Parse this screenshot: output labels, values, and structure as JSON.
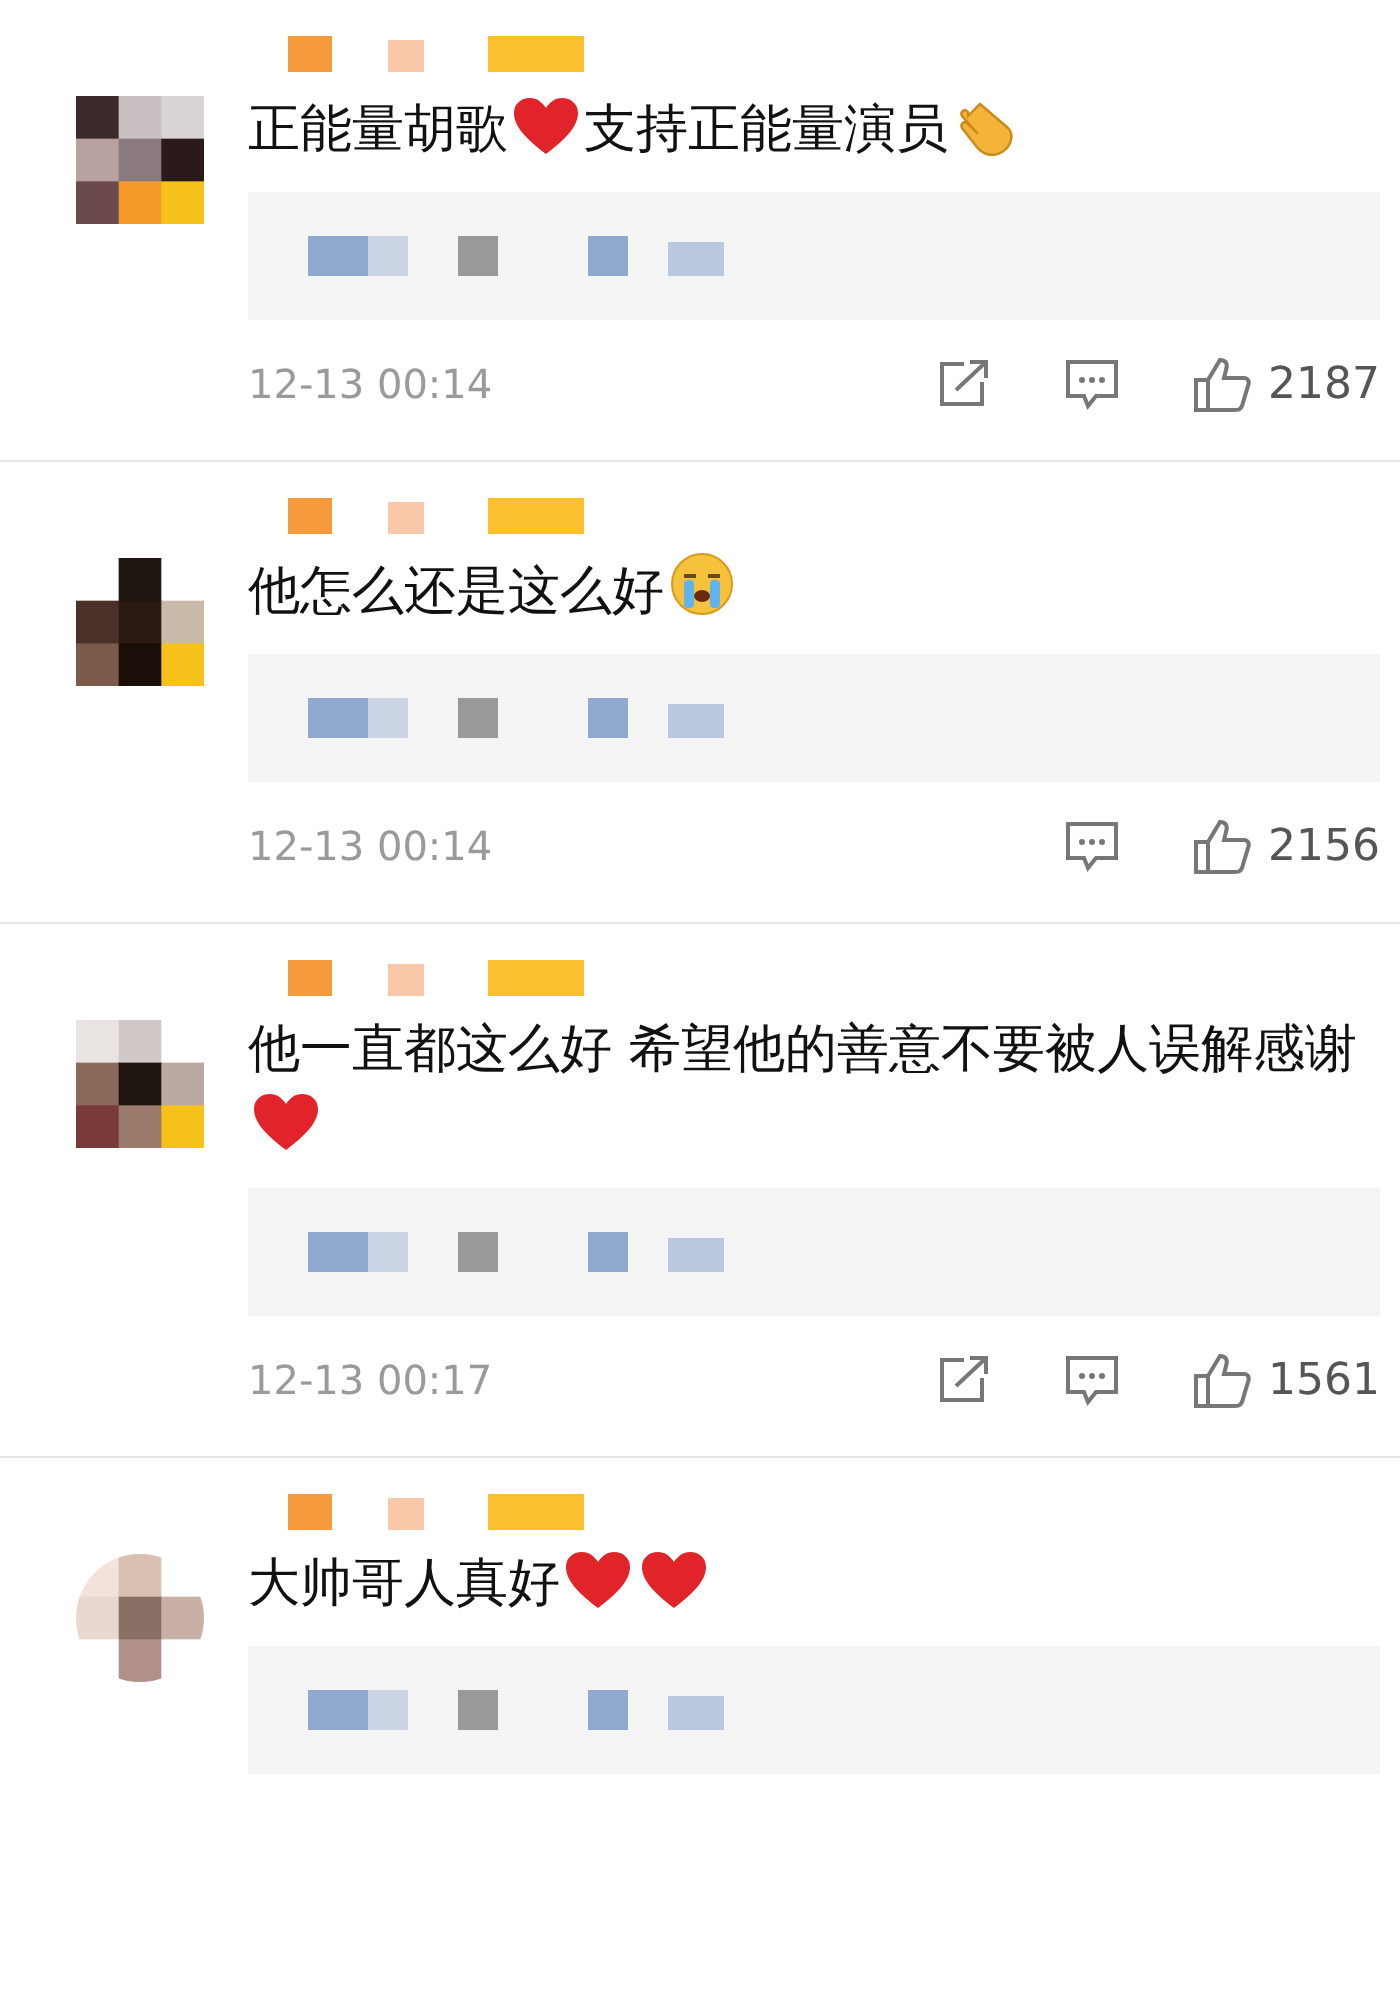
{
  "comments": [
    {
      "parts": [
        {
          "kind": "text",
          "text": "正能量胡歌"
        },
        {
          "kind": "heart"
        },
        {
          "kind": "text",
          "text": "支持正能量演员"
        },
        {
          "kind": "clap"
        }
      ],
      "time": "12-13 00:14",
      "share": true,
      "likes": "2187"
    },
    {
      "parts": [
        {
          "kind": "text",
          "text": "他怎么还是这么好"
        },
        {
          "kind": "cry"
        }
      ],
      "time": "12-13 00:14",
      "share": false,
      "likes": "2156"
    },
    {
      "parts": [
        {
          "kind": "text",
          "text": "他一直都这么好  希望他的善意不要被人误解感谢"
        },
        {
          "kind": "heart"
        }
      ],
      "time": "12-13 00:17",
      "share": true,
      "likes": "1561"
    },
    {
      "parts": [
        {
          "kind": "text",
          "text": "大帅哥人真好"
        },
        {
          "kind": "heart"
        },
        {
          "kind": "heart"
        }
      ]
    }
  ]
}
